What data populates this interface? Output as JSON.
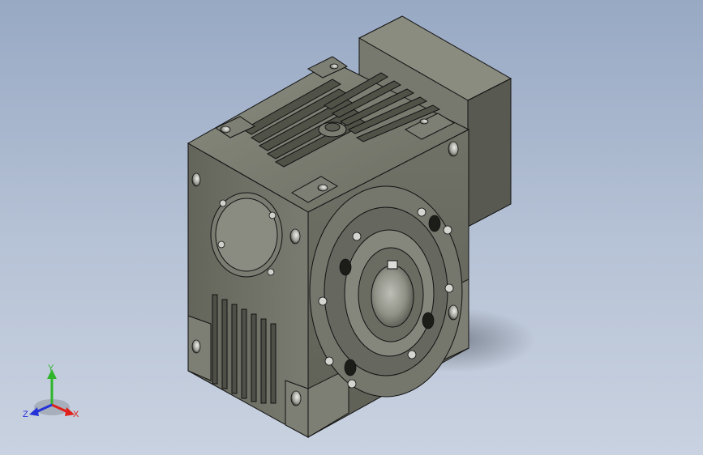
{
  "viewport": {
    "background_top": "#98a9c4",
    "background_bottom": "#c9d2e0",
    "model_color": "#6f7166",
    "edge_color": "#111111"
  },
  "triad": {
    "x_label": "X",
    "y_label": "Y",
    "z_label": "Z",
    "x_color": "#e0201a",
    "y_color": "#2fb52a",
    "z_color": "#2432d8"
  }
}
